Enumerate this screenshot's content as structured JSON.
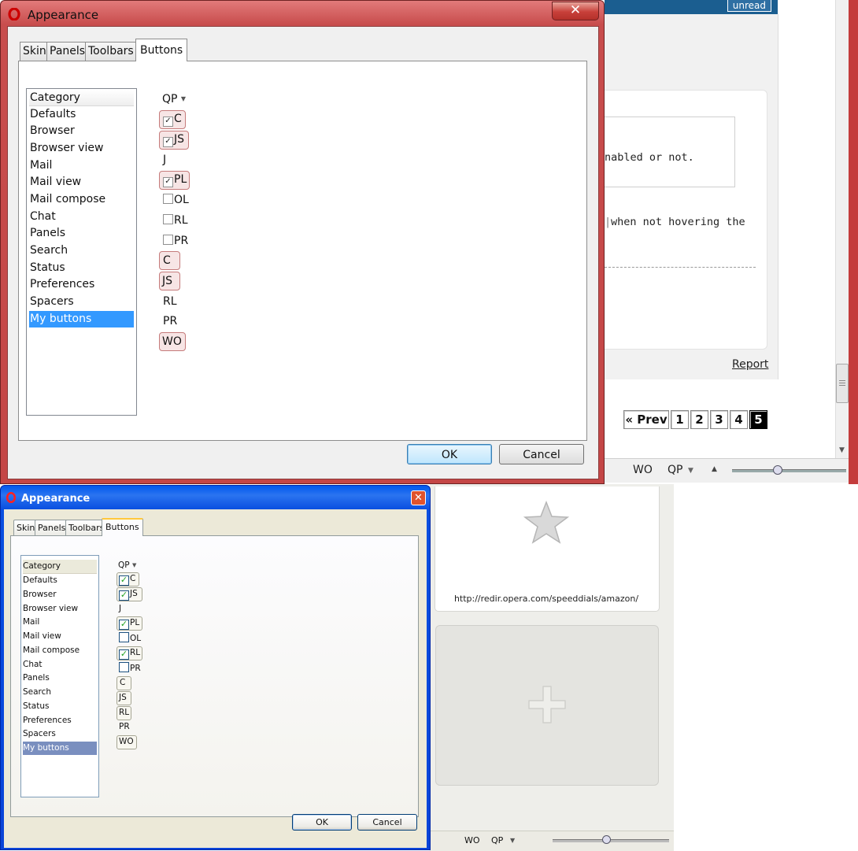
{
  "background_page": {
    "unread_label": "unread",
    "quote_fragment": "nabled or not.",
    "text_fragment": "when not hovering the",
    "report_link": "Report",
    "pager": {
      "prev": "« Prev",
      "pages": [
        "1",
        "2",
        "3",
        "4"
      ],
      "current": "5"
    },
    "status": {
      "wo": "WO",
      "qp": "QP"
    }
  },
  "speed_dial": {
    "url": "http://redir.opera.com/speeddials/amazon/",
    "status": {
      "wo": "WO",
      "qp": "QP"
    }
  },
  "dialog_win7": {
    "title": "Appearance",
    "close_label": "✕",
    "tabs": [
      "Skin",
      "Panels",
      "Toolbars",
      "Buttons"
    ],
    "active_tab": "Buttons",
    "categories_header": "Category",
    "categories": [
      "Defaults",
      "Browser",
      "Browser view",
      "Mail",
      "Mail view",
      "Mail compose",
      "Chat",
      "Panels",
      "Search",
      "Status",
      "Preferences",
      "Spacers",
      "My buttons"
    ],
    "selected_category": "My buttons",
    "qp_dropdown": "QP",
    "buttons": [
      {
        "label": "C",
        "kind": "checkbox",
        "checked": true,
        "highlight": true
      },
      {
        "label": "JS",
        "kind": "checkbox",
        "checked": true,
        "highlight": true
      },
      {
        "label": "J",
        "kind": "text"
      },
      {
        "label": "PL",
        "kind": "checkbox",
        "checked": true,
        "highlight": true
      },
      {
        "label": "OL",
        "kind": "checkbox",
        "checked": false
      },
      {
        "label": "RL",
        "kind": "checkbox",
        "checked": false
      },
      {
        "label": "PR",
        "kind": "checkbox",
        "checked": false
      },
      {
        "label": "C",
        "kind": "button"
      },
      {
        "label": "JS",
        "kind": "button"
      },
      {
        "label": "RL",
        "kind": "text"
      },
      {
        "label": "PR",
        "kind": "text"
      },
      {
        "label": "WO",
        "kind": "button"
      }
    ],
    "ok_label": "OK",
    "cancel_label": "Cancel"
  },
  "dialog_xp": {
    "title": "Appearance",
    "close_label": "✕",
    "tabs": [
      "Skin",
      "Panels",
      "Toolbars",
      "Buttons"
    ],
    "active_tab": "Buttons",
    "categories_header": "Category",
    "categories": [
      "Defaults",
      "Browser",
      "Browser view",
      "Mail",
      "Mail view",
      "Mail compose",
      "Chat",
      "Panels",
      "Search",
      "Status",
      "Preferences",
      "Spacers",
      "My buttons"
    ],
    "selected_category": "My buttons",
    "qp_dropdown": "QP",
    "buttons": [
      {
        "label": "C",
        "kind": "checkbox",
        "checked": true
      },
      {
        "label": "JS",
        "kind": "checkbox",
        "checked": true
      },
      {
        "label": "J",
        "kind": "text"
      },
      {
        "label": "PL",
        "kind": "checkbox",
        "checked": true
      },
      {
        "label": "OL",
        "kind": "checkbox",
        "checked": false
      },
      {
        "label": "RL",
        "kind": "checkbox",
        "checked": true
      },
      {
        "label": "PR",
        "kind": "checkbox",
        "checked": false
      },
      {
        "label": "C",
        "kind": "button"
      },
      {
        "label": "JS",
        "kind": "button"
      },
      {
        "label": "RL",
        "kind": "button"
      },
      {
        "label": "PR",
        "kind": "text"
      },
      {
        "label": "WO",
        "kind": "button"
      }
    ],
    "ok_label": "OK",
    "cancel_label": "Cancel"
  },
  "colors": {
    "win7_frame": "#c44646",
    "xp_frame": "#0a44d8",
    "win7_selection": "#3399ff",
    "xp_selection": "#7a8fbf",
    "chip_highlight": "#f7e5e5"
  }
}
